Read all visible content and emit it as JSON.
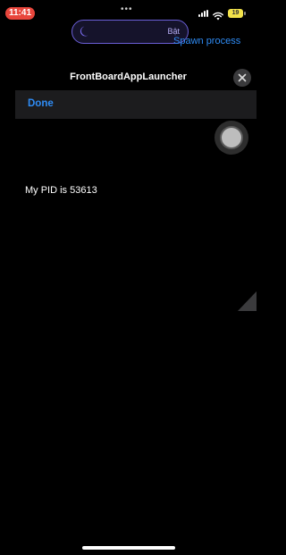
{
  "status_bar": {
    "time": "11:41",
    "more_dots": "•••",
    "battery_level": "19",
    "battery_color": "#f2e24a",
    "time_pill_color": "#e8463c",
    "signal_icon": "cellular-signal-icon",
    "wifi_icon": "wifi-icon"
  },
  "focus_island": {
    "icon": "moon-icon",
    "label": "Bật",
    "accent": "#6b5fd8"
  },
  "spawn_process_label": "Spawn process",
  "sheet": {
    "title": "FrontBoardAppLauncher",
    "close_icon": "close-icon",
    "done_label": "Done",
    "accent": "#2f8cf5"
  },
  "content": {
    "pid_text": "My PID is 53613"
  }
}
